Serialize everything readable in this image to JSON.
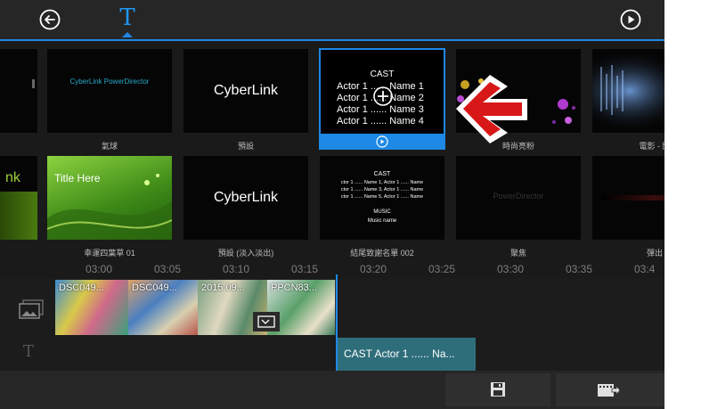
{
  "theme": {
    "accent": "#1e88e5",
    "teal_clip": "#2e6e7a",
    "tile_bg": "#050505"
  },
  "toolbar": {
    "back_icon": "back-circle-icon",
    "title_icon_label": "T",
    "play_icon": "play-circle-icon"
  },
  "row1": [
    {
      "id": "edge",
      "label": ""
    },
    {
      "id": "balloon",
      "label": "氣球",
      "preview_text": "CyberLink PowerDirector"
    },
    {
      "id": "default",
      "label": "預設",
      "preview_text": "CyberLink"
    },
    {
      "id": "cast",
      "label": "",
      "preview": {
        "heading": "CAST",
        "lines": [
          "Actor 1 ...... Name 1",
          "Actor 1 ...... Name 2",
          "Actor 1 ...... Name 3",
          "Actor 1 ...... Name 4"
        ]
      }
    },
    {
      "id": "fashion",
      "label": "時尚亮粉"
    },
    {
      "id": "movie",
      "label": "電影 - 閃"
    }
  ],
  "row2": [
    {
      "id": "edge2",
      "label": "",
      "preview_text": "nk"
    },
    {
      "id": "lucky",
      "label": "幸運四葉草 01",
      "preview_text": "Title Here"
    },
    {
      "id": "default-fade",
      "label": "預設 (淡入淡出)",
      "preview_text": "CyberLink"
    },
    {
      "id": "credits",
      "label": "結尾致謝名單 002",
      "preview": {
        "heading": "CAST",
        "lines": [
          "ctor 1 ...... Name 1, Actor 1 ...... Name",
          "ctor 1 ...... Name 3, Actor 1 ...... Name",
          "ctor 1 ...... Name 5, Actor 1 ...... Name"
        ],
        "music_heading": "MUSIC",
        "music_line": "Music name"
      }
    },
    {
      "id": "focus",
      "label": "聚焦",
      "preview_text": "PowerDirector"
    },
    {
      "id": "popout",
      "label": "彈出"
    }
  ],
  "timeline": {
    "ticks": [
      "03:00",
      "03:05",
      "03:10",
      "03:15",
      "03:20",
      "03:25",
      "03:30",
      "03:35",
      "03:4"
    ],
    "clips": [
      {
        "name": "DSC049..."
      },
      {
        "name": "DSC049..."
      },
      {
        "name": "2015 09..."
      },
      {
        "name": "PPCN83..."
      }
    ],
    "title_clip": "CAST Actor 1 ...... Na...",
    "video_track_icon": "image-track-icon",
    "title_track_icon": "title-track-icon",
    "title_track_label": "T"
  },
  "bottom": {
    "save_icon": "save-icon",
    "produce_icon": "produce-video-icon"
  }
}
